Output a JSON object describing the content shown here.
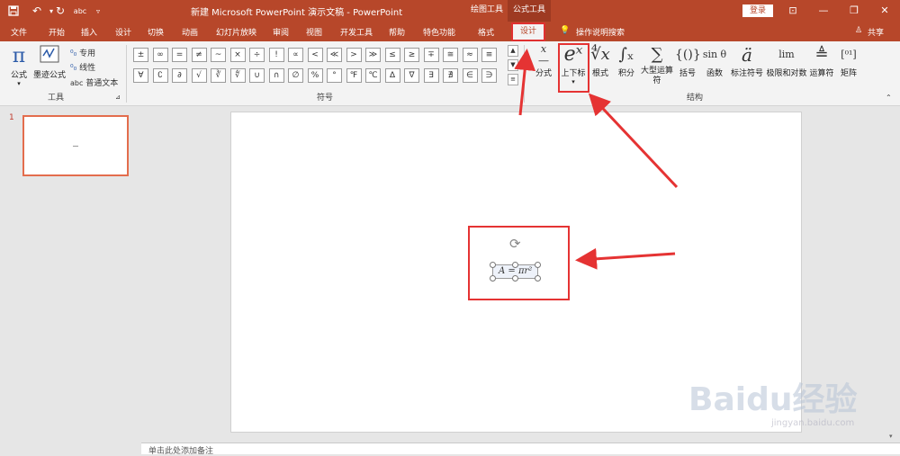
{
  "window": {
    "title": "新建 Microsoft PowerPoint 演示文稿  -  PowerPoint",
    "login": "登录",
    "context_drawing": "绘图工具",
    "context_equation": "公式工具"
  },
  "qat": {
    "save": "save-icon",
    "undo": "undo-icon",
    "redo": "redo-icon",
    "spell": "spell-check-icon",
    "customize": "customize-icon"
  },
  "tabs": [
    "文件",
    "开始",
    "插入",
    "设计",
    "切换",
    "动画",
    "幻灯片放映",
    "审阅",
    "视图",
    "开发工具",
    "帮助",
    "特色功能",
    "格式",
    "设计"
  ],
  "tell_me": "操作说明搜索",
  "share": "共享",
  "tools_group": {
    "label": "工具",
    "equation": "公式",
    "ink": "墨迹公式",
    "professional": "专用",
    "linear": "线性",
    "abc": "abc",
    "normal_text": "普通文本"
  },
  "symbols_group": {
    "label": "符号",
    "row1": [
      "±",
      "∞",
      "=",
      "≠",
      "~",
      "×",
      "÷",
      "!",
      "∝",
      "<",
      "≪",
      ">",
      "≫",
      "≤",
      "≥",
      "∓",
      "≅",
      "≈",
      "≡"
    ],
    "row2": [
      "∀",
      "∁",
      "∂",
      "√",
      "∛",
      "∜",
      "∪",
      "∩",
      "∅",
      "%",
      "°",
      "℉",
      "℃",
      "∆",
      "∇",
      "∃",
      "∄",
      "∈",
      "∋"
    ]
  },
  "structures_group": {
    "label": "结构",
    "items": [
      {
        "label": "分式",
        "icon": "x/y"
      },
      {
        "label": "上下标",
        "icon": "eˣ"
      },
      {
        "label": "根式",
        "icon": "ⁿ√x"
      },
      {
        "label": "积分",
        "icon": "∫"
      },
      {
        "label": "大型运算符",
        "icon": "∑"
      },
      {
        "label": "括号",
        "icon": "{()}"
      },
      {
        "label": "函数",
        "icon": "sinθ"
      },
      {
        "label": "标注符号",
        "icon": "ä"
      },
      {
        "label": "极限和对数",
        "icon": "lim"
      },
      {
        "label": "运算符",
        "icon": "△"
      },
      {
        "label": "矩阵",
        "icon": "[10;01]"
      }
    ]
  },
  "slides": [
    {
      "number": "1"
    }
  ],
  "equation": {
    "text": "A = πr²"
  },
  "notes_placeholder": "单击此处添加备注",
  "watermark": {
    "logo": "Baidu经验",
    "url": "jingyan.baidu.com"
  },
  "colors": {
    "accent": "#b7472a",
    "highlight": "#e53333"
  }
}
